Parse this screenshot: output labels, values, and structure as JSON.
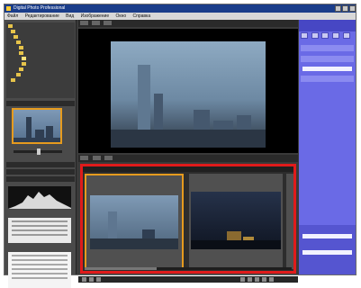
{
  "window": {
    "title": "Digital Photo Professional"
  },
  "menu": [
    "Файл",
    "Редактирование",
    "Вид",
    "Изображение",
    "Окно",
    "Справка"
  ],
  "tree": [
    "",
    "",
    "",
    "",
    "",
    "",
    "",
    "",
    "",
    "",
    ""
  ],
  "panels": {
    "navigator": "",
    "histogram": "",
    "tool1": "",
    "tool2": ""
  },
  "center": {
    "toolbar": {
      "t1": "",
      "t2": ""
    },
    "filmstrip": {
      "header": "",
      "items": [
        {
          "caption": ""
        },
        {
          "caption": ""
        },
        {
          "caption": ""
        }
      ]
    }
  },
  "right": {
    "title": "",
    "label_a": "",
    "label_b": ""
  },
  "colors": {
    "selection_outline": "#e01b1b",
    "selected_frame": "#e69b1e",
    "title_bar": "#1a3d8a",
    "right_panel": "#6a6ae6"
  }
}
